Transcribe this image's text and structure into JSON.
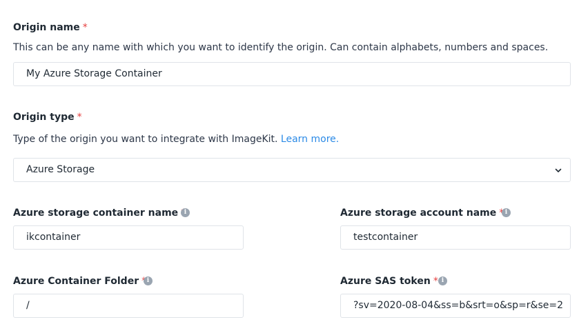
{
  "origin_name": {
    "label": "Origin name",
    "required_mark": "*",
    "help": "This can be any name with which you want to identify the origin. Can contain alphabets, numbers and spaces.",
    "value": "My Azure Storage Container"
  },
  "origin_type": {
    "label": "Origin type",
    "required_mark": "*",
    "help": "Type of the origin you want to integrate with ImageKit.",
    "learn_more": "Learn more.",
    "selected": "Azure Storage"
  },
  "container_name": {
    "label": "Azure storage container name",
    "required_mark": "*",
    "value": "ikcontainer"
  },
  "account_name": {
    "label": "Azure storage account name",
    "required_mark": "*",
    "value": "testcontainer"
  },
  "container_folder": {
    "label": "Azure Container Folder",
    "required_mark": "*",
    "value": "/"
  },
  "sas_token": {
    "label": "Azure SAS token",
    "required_mark": "*",
    "value": "?sv=2020-08-04&ss=b&srt=o&sp=r&se=2"
  },
  "icons": {
    "info": "info-icon",
    "chevron": "chevron-down-icon"
  },
  "colors": {
    "required": "#e53e3e",
    "link": "#2b8ae6",
    "border": "#dfe3e8",
    "info_icon": "#9aa5b1"
  }
}
